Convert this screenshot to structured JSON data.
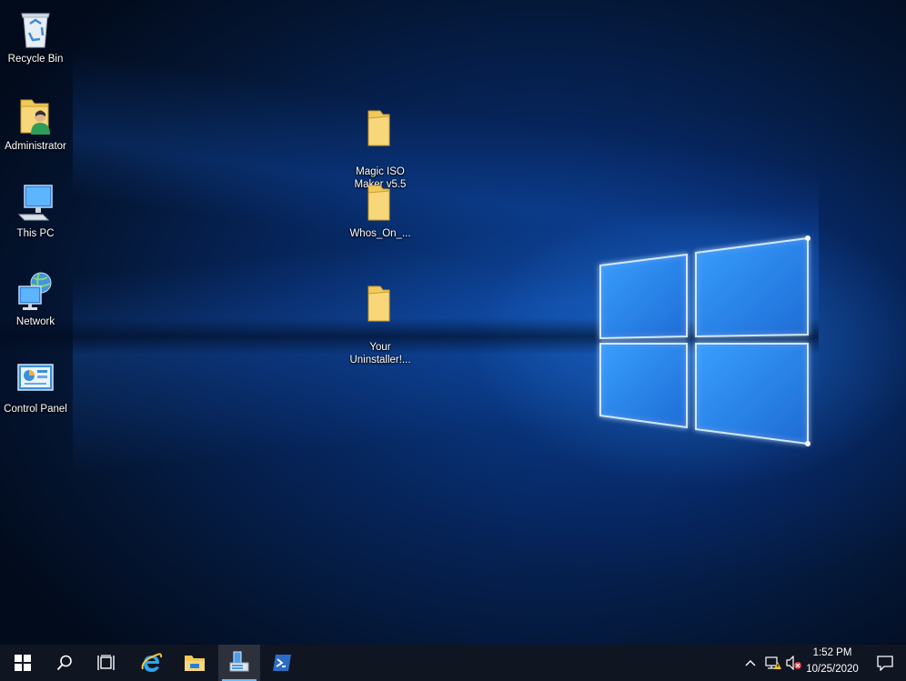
{
  "desktop": {
    "icons": [
      {
        "label": "Recycle Bin",
        "icon": "recycle-bin-icon"
      },
      {
        "label": "Administrator",
        "icon": "user-folder-icon"
      },
      {
        "label": "This PC",
        "icon": "computer-icon"
      },
      {
        "label": "Network",
        "icon": "network-icon"
      },
      {
        "label": "Control Panel",
        "icon": "control-panel-icon"
      },
      {
        "label": "Magic ISO\nMaker v5.5",
        "icon": "folder-icon"
      },
      {
        "label": "Whos_On_...",
        "icon": "folder-icon"
      },
      {
        "label": "Your\nUninstaller!...",
        "icon": "folder-icon"
      }
    ]
  },
  "taskbar": {
    "buttons": [
      {
        "icon": "windows-start-icon"
      },
      {
        "icon": "search-icon"
      },
      {
        "icon": "task-view-icon"
      },
      {
        "icon": "internet-explorer-icon"
      },
      {
        "icon": "file-explorer-icon"
      },
      {
        "icon": "server-manager-icon"
      },
      {
        "icon": "powershell-icon"
      }
    ],
    "tray": {
      "icons": [
        "chevron-up-icon",
        "network-warning-icon",
        "volume-muted-icon"
      ],
      "time": "1:52 PM",
      "date": "10/25/2020"
    }
  },
  "colors": {
    "accent": "#0a78d7",
    "taskbar": "#101522",
    "folder": "#f2c85b"
  }
}
